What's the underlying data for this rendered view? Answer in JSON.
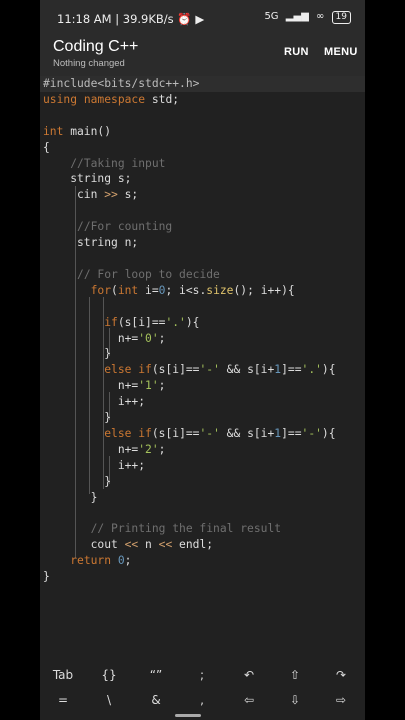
{
  "status": {
    "time": "11:18 AM | 39.9KB/s",
    "alarm_icon": "alarm-icon",
    "video_icon": "video-icon",
    "network": "5G",
    "battery": "19"
  },
  "appbar": {
    "title": "Coding C++",
    "subtitle": "Nothing changed",
    "run": "RUN",
    "menu": "MENU"
  },
  "code": {
    "lines": [
      "#include<bits/stdc++.h>",
      "using namespace std;",
      "",
      "int main()",
      "{",
      "    //Taking input",
      "    string s;",
      "     cin >> s;",
      "",
      "     //For counting",
      "     string n;",
      "",
      "     // For loop to decide",
      "       for(int i=0; i<s.size(); i++){",
      "",
      "         if(s[i]=='.'){",
      "           n+='0';",
      "         }",
      "         else if(s[i]=='-' && s[i+1]=='.'){",
      "           n+='1';",
      "           i++;",
      "         }",
      "         else if(s[i]=='-' && s[i+1]=='-'){",
      "           n+='2';",
      "           i++;",
      "         }",
      "       }",
      "",
      "       // Printing the final result",
      "       cout << n << endl;",
      "    return 0;",
      "}"
    ]
  },
  "keyboard": {
    "row1": [
      "Tab",
      "{}",
      "“”",
      ";",
      "↶",
      "⇧",
      "↷"
    ],
    "row2": [
      "=",
      "\\",
      "&",
      ",",
      "⇦",
      "⇩",
      "⇨"
    ]
  }
}
